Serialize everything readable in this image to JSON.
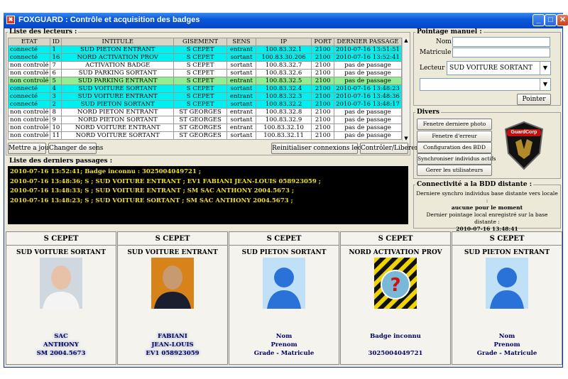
{
  "window": {
    "title": "FOXGUARD : Contrôle et acquisition des badges",
    "icon": "foxguard-app-icon"
  },
  "readers": {
    "section_label": "Liste des lecteurs :",
    "columns": [
      "ETAT",
      "ID",
      "INTITULE",
      "GISEMENT",
      "SENS",
      "IP",
      "PORT",
      "DERNIER PASSAGE"
    ],
    "rows": [
      {
        "etat": "connecté",
        "id": "1",
        "intitule": "SUD PIETON ENTRANT",
        "gisement": "S CEPET",
        "sens": "entrant",
        "ip": "100.83.32.1",
        "port": "2100",
        "dernier": "2010-07-16 13:51:51",
        "status": "cyan"
      },
      {
        "etat": "connecté",
        "id": "16",
        "intitule": "NORD ACTIVATION PROV",
        "gisement": "S CEPET",
        "sens": "sortant",
        "ip": "100.83.30.206",
        "port": "2100",
        "dernier": "2010-07-16 13:52:41",
        "status": "cyan"
      },
      {
        "etat": "non controlé",
        "id": "7",
        "intitule": "ACTIVATION BADGE",
        "gisement": "S CEPET",
        "sens": "sortant",
        "ip": "100.83.32.7",
        "port": "2100",
        "dernier": "pas de passage",
        "status": "white"
      },
      {
        "etat": "non controlé",
        "id": "6",
        "intitule": "SUD PARKING SORTANT",
        "gisement": "S CEPET",
        "sens": "sortant",
        "ip": "100.83.32.6",
        "port": "2100",
        "dernier": "pas de passage",
        "status": "white"
      },
      {
        "etat": "non controlé",
        "id": "5",
        "intitule": "SUD PARKING ENTRANT",
        "gisement": "S CEPET",
        "sens": "entrant",
        "ip": "100.83.32.5",
        "port": "2100",
        "dernier": "pas de passage",
        "status": "green"
      },
      {
        "etat": "connecté",
        "id": "4",
        "intitule": "SUD VOITURE SORTANT",
        "gisement": "S CEPET",
        "sens": "sortant",
        "ip": "100.83.32.4",
        "port": "2100",
        "dernier": "2010-07-16 13:48:23",
        "status": "cyan"
      },
      {
        "etat": "connecté",
        "id": "3",
        "intitule": "SUD VOITURE ENTRANT",
        "gisement": "S CEPET",
        "sens": "entrant",
        "ip": "100.83.32.3",
        "port": "2100",
        "dernier": "2010-07-16 13:48:36",
        "status": "cyan"
      },
      {
        "etat": "connecté",
        "id": "2",
        "intitule": "SUD PIETON SORTANT",
        "gisement": "S CEPET",
        "sens": "sortant",
        "ip": "100.83.32.2",
        "port": "2100",
        "dernier": "2010-07-16 13:48:17",
        "status": "cyan"
      },
      {
        "etat": "non controlé",
        "id": "8",
        "intitule": "NORD PIETON ENTRANT",
        "gisement": "ST GEORGES",
        "sens": "entrant",
        "ip": "100.83.32.8",
        "port": "2100",
        "dernier": "pas de passage",
        "status": "white"
      },
      {
        "etat": "non controlé",
        "id": "9",
        "intitule": "NORD PIETON SORTANT",
        "gisement": "ST GEORGES",
        "sens": "sortant",
        "ip": "100.83.32.9",
        "port": "2100",
        "dernier": "pas de passage",
        "status": "white"
      },
      {
        "etat": "non controlé",
        "id": "10",
        "intitule": "NORD VOITURE ENTRANT",
        "gisement": "ST GEORGES",
        "sens": "entrant",
        "ip": "100.83.32.10",
        "port": "2100",
        "dernier": "pas de passage",
        "status": "white"
      },
      {
        "etat": "non controlé",
        "id": "11",
        "intitule": "NORD VOITURE SORTANT",
        "gisement": "ST GEORGES",
        "sens": "sortant",
        "ip": "100.83.32.11",
        "port": "2100",
        "dernier": "pas de passage",
        "status": "white"
      }
    ],
    "buttons": {
      "refresh": "Mettre a jour",
      "change_direction": "Changer de sens",
      "reset_connections": "Reinitialiser connexions lecteurs",
      "control_free": "Contrôler/Liberer"
    }
  },
  "passages": {
    "section_label": "Liste des derniers passages :",
    "lines": [
      "2010-07-16 13:52:41; Badge inconnu : 3025004049721 ;",
      "2010-07-16 13:48:36; S ; SUD VOITURE ENTRANT ; EV1 FABIANI JEAN-LOUIS 058923059 ;",
      "2010-07-16 13:48:33; S ; SUD VOITURE ENTRANT ; SM SAC ANTHONY 2004.5673 ;",
      "2010-07-16 13:48:23; S ; SUD VOITURE SORTANT ; SM SAC ANTHONY 2004.5673 ;"
    ]
  },
  "manual": {
    "section_label": "Pointage manuel :",
    "nom_label": "Nom :",
    "matricule_label": "Matricule :",
    "lecteur_label": "Lecteur :",
    "lecteur_value": "SUD VOITURE SORTANT",
    "second_value": "",
    "pointer_button": "Pointer"
  },
  "divers": {
    "section_label": "Divers",
    "buttons": [
      "Fenetre derniere photo",
      "Fenetre d'erreur",
      "Configuration des BDD",
      "Synchroniser individus actifs",
      "Gerer les utilisateurs"
    ],
    "logo_text": "GuardCorp"
  },
  "remote": {
    "section_label": "Connectivité a la BDD distante :",
    "sync_label": "Derniere synchro individus base distante vers locale :",
    "sync_value": "aucune pour le moment",
    "last_label": "Dernier pointage local enregistré sur la base distante :",
    "last_value": "2010-07-16 13:48:41"
  },
  "cards": [
    {
      "zone": "S CEPET",
      "reader": "SUD VOITURE SORTANT",
      "photo": "person-photo-blurred",
      "l1": "SAC",
      "l2": "ANTHONY",
      "l3": "SM 2004.5673"
    },
    {
      "zone": "S CEPET",
      "reader": "SUD VOITURE ENTRANT",
      "photo": "person-photo-blurred",
      "l1": "FABIANI",
      "l2": "JEAN-LOUIS",
      "l3": "EV1 058923059"
    },
    {
      "zone": "S CEPET",
      "reader": "SUD PIETON SORTANT",
      "photo": "placeholder-person-icon",
      "l1": "Nom",
      "l2": "Prenom",
      "l3": "Grade - Matricule"
    },
    {
      "zone": "S CEPET",
      "reader": "NORD ACTIVATION PROV",
      "photo": "unknown-badge-icon",
      "l1": "Badge inconnu",
      "l2": "",
      "l3": "3025004049721"
    },
    {
      "zone": "S CEPET",
      "reader": "SUD PIETON ENTRANT",
      "photo": "placeholder-person-icon",
      "l1": "Nom",
      "l2": "Prenom",
      "l3": "Grade - Matricule"
    }
  ],
  "colors": {
    "connected": "#00f0f0",
    "selected": "#90ee90",
    "log_bg": "#000000",
    "log_text": "#f0e020",
    "title_bar": "#0a58d8"
  }
}
